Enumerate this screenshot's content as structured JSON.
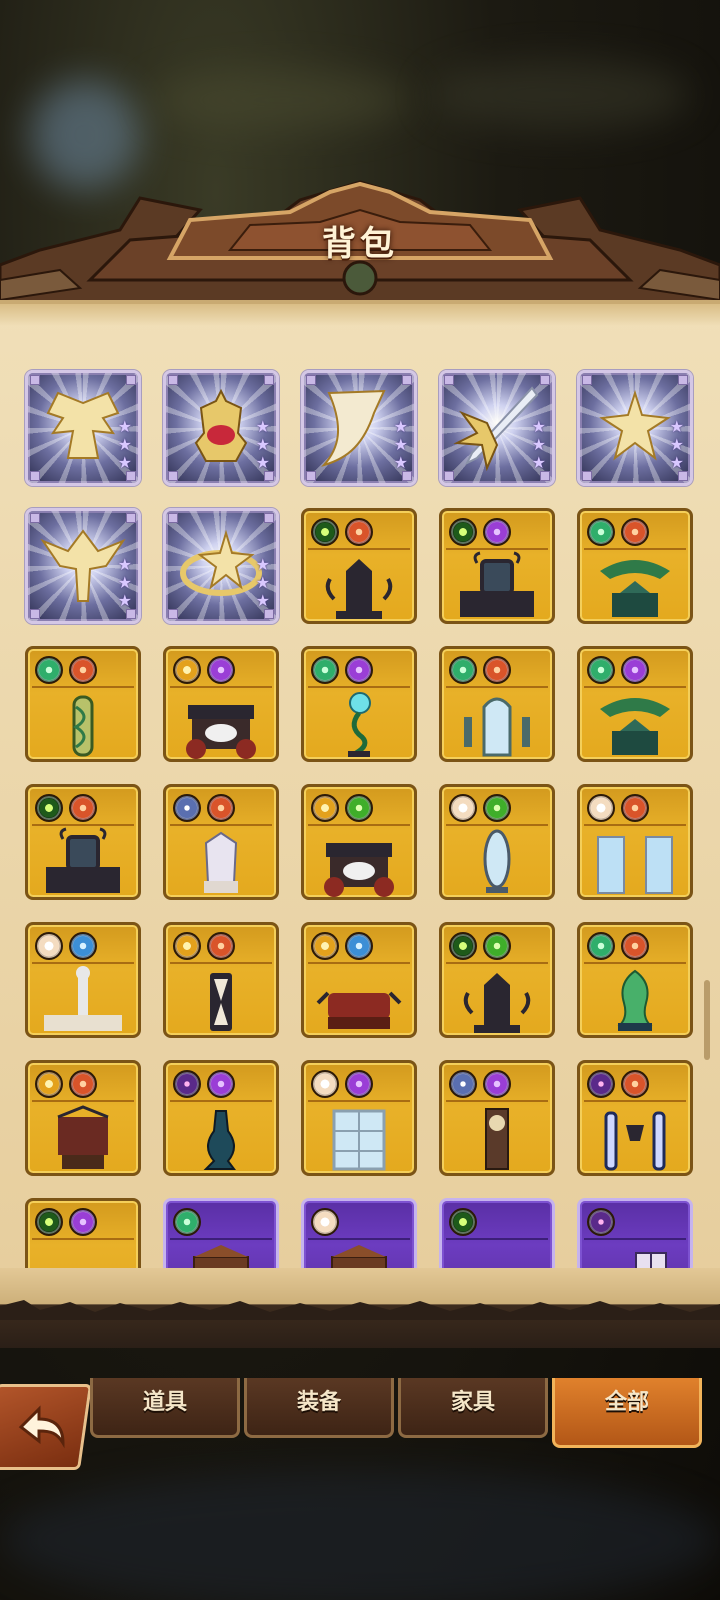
{
  "title": "背包",
  "tabs": [
    {
      "label": "道具",
      "active": false
    },
    {
      "label": "装备",
      "active": false
    },
    {
      "label": "家具",
      "active": false
    },
    {
      "label": "全部",
      "active": true
    }
  ],
  "colors": {
    "gold_frame": "#e4a91e",
    "purple_frame": "#6c3cc0",
    "white_frame": "#cfd2f0",
    "active_tab": "#e0812c"
  },
  "items": [
    {
      "kind": "equipment",
      "rarity": "white",
      "stars": 3,
      "icon": "wings-cape-icon"
    },
    {
      "kind": "equipment",
      "rarity": "white",
      "stars": 3,
      "icon": "lantern-chalice-icon"
    },
    {
      "kind": "equipment",
      "rarity": "white",
      "stars": 3,
      "icon": "horn-icon"
    },
    {
      "kind": "equipment",
      "rarity": "white",
      "stars": 3,
      "icon": "leaf-sword-icon"
    },
    {
      "kind": "equipment",
      "rarity": "white",
      "stars": 3,
      "icon": "star-crown-icon"
    },
    {
      "kind": "equipment",
      "rarity": "white",
      "stars": 3,
      "icon": "winged-helm-icon"
    },
    {
      "kind": "equipment",
      "rarity": "white",
      "stars": 3,
      "icon": "star-ring-icon"
    },
    {
      "kind": "furniture",
      "rarity": "gold",
      "badges": [
        "eye",
        "flame"
      ],
      "icon": "dark-throne-icon"
    },
    {
      "kind": "furniture",
      "rarity": "gold",
      "badges": [
        "eye",
        "orb"
      ],
      "icon": "dark-vanity-icon"
    },
    {
      "kind": "furniture",
      "rarity": "gold",
      "badges": [
        "leaf",
        "flame"
      ],
      "icon": "canopy-shrine-icon"
    },
    {
      "kind": "furniture",
      "rarity": "gold",
      "badges": [
        "leaf",
        "flame"
      ],
      "icon": "vine-pillar-icon"
    },
    {
      "kind": "furniture",
      "rarity": "gold",
      "badges": [
        "sun",
        "orb"
      ],
      "icon": "red-gate-icon"
    },
    {
      "kind": "furniture",
      "rarity": "gold",
      "badges": [
        "leaf",
        "orb"
      ],
      "icon": "vine-orb-stand-icon"
    },
    {
      "kind": "furniture",
      "rarity": "gold",
      "badges": [
        "leaf",
        "flame"
      ],
      "icon": "arched-mirror-icon"
    },
    {
      "kind": "furniture",
      "rarity": "gold",
      "badges": [
        "leaf",
        "orb"
      ],
      "icon": "canopy-shrine-icon"
    },
    {
      "kind": "furniture",
      "rarity": "gold",
      "badges": [
        "eye",
        "flame"
      ],
      "icon": "dark-vanity-icon"
    },
    {
      "kind": "furniture",
      "rarity": "gold",
      "badges": [
        "star",
        "flame"
      ],
      "icon": "crystal-chair-icon"
    },
    {
      "kind": "furniture",
      "rarity": "gold",
      "badges": [
        "sun",
        "gem"
      ],
      "icon": "red-gate-icon"
    },
    {
      "kind": "furniture",
      "rarity": "gold",
      "badges": [
        "light",
        "gem"
      ],
      "icon": "standing-mirror-icon"
    },
    {
      "kind": "furniture",
      "rarity": "gold",
      "badges": [
        "light",
        "flame"
      ],
      "icon": "stained-windows-icon"
    },
    {
      "kind": "furniture",
      "rarity": "gold",
      "badges": [
        "light",
        "water"
      ],
      "icon": "statue-fountain-icon"
    },
    {
      "kind": "furniture",
      "rarity": "gold",
      "badges": [
        "sun",
        "flame"
      ],
      "icon": "hourglass-icon"
    },
    {
      "kind": "furniture",
      "rarity": "gold",
      "badges": [
        "sun",
        "water"
      ],
      "icon": "red-sofa-icon"
    },
    {
      "kind": "furniture",
      "rarity": "gold",
      "badges": [
        "eye",
        "gem"
      ],
      "icon": "dark-throne-icon"
    },
    {
      "kind": "furniture",
      "rarity": "gold",
      "badges": [
        "leaf",
        "flame"
      ],
      "icon": "jade-vase-icon"
    },
    {
      "kind": "furniture",
      "rarity": "gold",
      "badges": [
        "sun",
        "flame"
      ],
      "icon": "banner-stand-icon"
    },
    {
      "kind": "furniture",
      "rarity": "gold",
      "badges": [
        "void",
        "orb"
      ],
      "icon": "dark-vase-icon"
    },
    {
      "kind": "furniture",
      "rarity": "gold",
      "badges": [
        "light",
        "orb"
      ],
      "icon": "lattice-window-icon"
    },
    {
      "kind": "furniture",
      "rarity": "gold",
      "badges": [
        "star",
        "orb"
      ],
      "icon": "grandfather-clock-icon"
    },
    {
      "kind": "furniture",
      "rarity": "gold",
      "badges": [
        "void",
        "flame"
      ],
      "icon": "twin-pillars-icon"
    },
    {
      "kind": "furniture",
      "rarity": "gold",
      "badges": [
        "eye",
        "orb"
      ],
      "icon": "round-bed-icon"
    },
    {
      "kind": "furniture",
      "rarity": "purple",
      "badges": [
        "leaf"
      ],
      "icon": "cabinet-icon"
    },
    {
      "kind": "furniture",
      "rarity": "purple",
      "badges": [
        "light"
      ],
      "icon": "cabinet-icon"
    },
    {
      "kind": "furniture",
      "rarity": "purple",
      "badges": [
        "eye"
      ],
      "icon": "table-set-icon"
    },
    {
      "kind": "furniture",
      "rarity": "purple",
      "badges": [
        "void"
      ],
      "icon": "window-desk-icon"
    }
  ]
}
